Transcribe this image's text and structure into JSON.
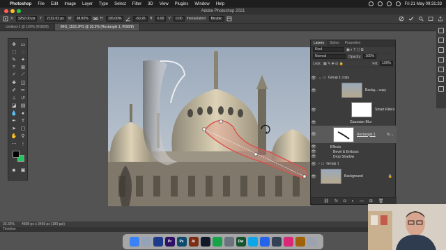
{
  "menubar": {
    "app": "Photoshop",
    "items": [
      "File",
      "Edit",
      "Image",
      "Layer",
      "Type",
      "Select",
      "Filter",
      "3D",
      "View",
      "Plugins",
      "Window",
      "Help"
    ],
    "clock": "Fri 21 May  09:31:33"
  },
  "window": {
    "title": "Adobe Photoshop 2021"
  },
  "options": {
    "x": "3252.00 px",
    "y": "2132.02 px",
    "w": "98.82%",
    "h": "105.00%",
    "angle": "-60.26",
    "hskew": "0.00",
    "vskew": "0.00",
    "interpolation_label": "Interpolation:",
    "interpolation": "Bicubic"
  },
  "tabs": [
    {
      "label": "Untitled-1 @ 100% (RGB/8)",
      "active": false
    },
    {
      "label": "IMG_1183.JPG @ 33.3% (Rectangle 1, RGB/8)",
      "active": true
    }
  ],
  "layers_panel": {
    "tabs": [
      "Layers",
      "Styles",
      "Properties"
    ],
    "kind": "Kind",
    "blend_mode": "Normal",
    "opacity_label": "Opacity:",
    "opacity": "100%",
    "lock_label": "Lock:",
    "fill_label": "Fill:",
    "fill": "100%",
    "rows": [
      {
        "type": "group",
        "name": "Group 1 copy"
      },
      {
        "type": "layer",
        "name": "Backg... copy"
      },
      {
        "type": "sub",
        "name": "Smart Filters"
      },
      {
        "type": "sub",
        "name": "Gaussian Blur"
      },
      {
        "type": "layer",
        "name": "Rectangle 1",
        "selected": true
      },
      {
        "type": "sub",
        "name": "Effects"
      },
      {
        "type": "sub",
        "name": "Bevel & Emboss"
      },
      {
        "type": "sub",
        "name": "Drop Shadow"
      },
      {
        "type": "group",
        "name": "Group 1"
      },
      {
        "type": "layer",
        "name": "Background"
      }
    ]
  },
  "status": {
    "zoom": "33.33%",
    "doc": "4608 px x 3456 px (180 ppi)"
  },
  "timeline": "Timeline",
  "dock": [
    {
      "name": "Finder",
      "color": "#3b82f6"
    },
    {
      "name": "Launchpad",
      "color": "#94a3b8"
    },
    {
      "name": "Bridge",
      "color": "#1e3a8a"
    },
    {
      "name": "Pr",
      "color": "#2e1065"
    },
    {
      "name": "Ps",
      "color": "#0c4a6e"
    },
    {
      "name": "Ai",
      "color": "#7c2d12"
    },
    {
      "name": "Media",
      "color": "#111827"
    },
    {
      "name": "Chrome",
      "color": "#16a34a"
    },
    {
      "name": "Settings",
      "color": "#6b7280"
    },
    {
      "name": "Dw",
      "color": "#14532d"
    },
    {
      "name": "Files",
      "color": "#0ea5e9"
    },
    {
      "name": "Zoom",
      "color": "#2563eb"
    },
    {
      "name": "Camera",
      "color": "#334155"
    },
    {
      "name": "Music",
      "color": "#db2777"
    },
    {
      "name": "Notes",
      "color": "#a16207"
    },
    {
      "name": "Trash",
      "color": "#9ca3af"
    }
  ]
}
